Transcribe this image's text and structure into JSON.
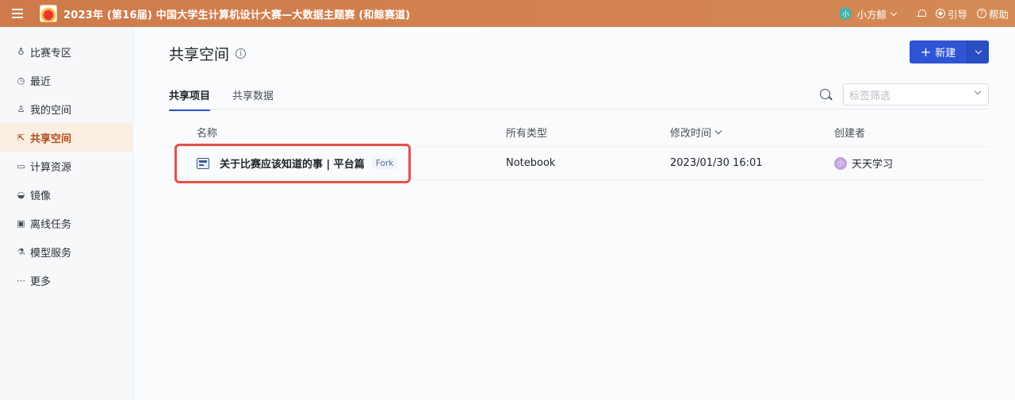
{
  "header": {
    "title": "2023年 (第16届) 中国大学生计算机设计大赛—大数据主题赛 (和鲸赛道)",
    "user_avatar": "小",
    "user_name": "小方鲸",
    "guide_label": "引导",
    "help_label": "帮助",
    "bg_color": "#d3814f"
  },
  "sidebar": {
    "items": [
      {
        "label": "比赛专区",
        "icon": "trophy-icon",
        "active": false
      },
      {
        "label": "最近",
        "icon": "clock-icon",
        "active": false
      },
      {
        "label": "我的空间",
        "icon": "user-icon",
        "active": false
      },
      {
        "label": "共享空间",
        "icon": "share-icon",
        "active": true
      },
      {
        "label": "计算资源",
        "icon": "cpu-icon",
        "active": false
      },
      {
        "label": "镜像",
        "icon": "image-icon",
        "active": false
      },
      {
        "label": "离线任务",
        "icon": "task-icon",
        "active": false
      },
      {
        "label": "模型服务",
        "icon": "flask-icon",
        "active": false
      },
      {
        "label": "更多",
        "icon": "more-icon",
        "active": false
      }
    ]
  },
  "main": {
    "page_title": "共享空间",
    "new_button_label": "新建",
    "tabs": [
      {
        "label": "共享项目",
        "active": true
      },
      {
        "label": "共享数据",
        "active": false
      }
    ],
    "tag_filter_placeholder": "标签筛选",
    "table": {
      "columns": [
        "名称",
        "所有类型",
        "修改时间",
        "创建者"
      ],
      "rows": [
        {
          "name": "关于比赛应该知道的事 | 平台篇",
          "tag": "Fork",
          "type": "Notebook",
          "modified": "2023/01/30 16:01",
          "creator_avatar": "小",
          "creator": "天天学习"
        }
      ]
    }
  },
  "colors": {
    "accent": "#2f55d4",
    "active_side_bg": "#fbeee3",
    "active_side_text": "#b24d1c",
    "highlight": "#e5504a"
  }
}
